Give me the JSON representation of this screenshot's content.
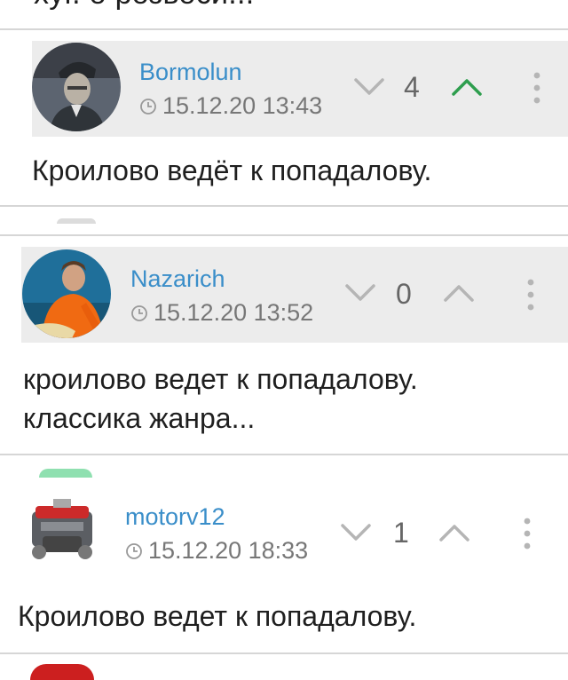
{
  "top_cutoff_text": "хуг. о розвоси...",
  "comments": [
    {
      "author": "Bormolun",
      "date": "15.12.20 13:43",
      "score": "4",
      "voted_up": true,
      "text": "Кроилово ведёт к попадалову.",
      "avatar": "avatar-officer"
    },
    {
      "author": "Nazarich",
      "date": "15.12.20 13:52",
      "score": "0",
      "voted_up": false,
      "text": "кроилово ведет к попадалову. классика жанра...",
      "avatar": "avatar-orange-shirt"
    },
    {
      "author": "motorv12",
      "date": "15.12.20 18:33",
      "score": "1",
      "voted_up": false,
      "text": "Кроилово ведет к попадалову.",
      "avatar": "avatar-engine"
    }
  ],
  "colors": {
    "author": "#3a8ec9",
    "vote_up_active": "#2e9e4e",
    "icon_inactive": "#b5b5b5",
    "header_band": "#ececec"
  }
}
